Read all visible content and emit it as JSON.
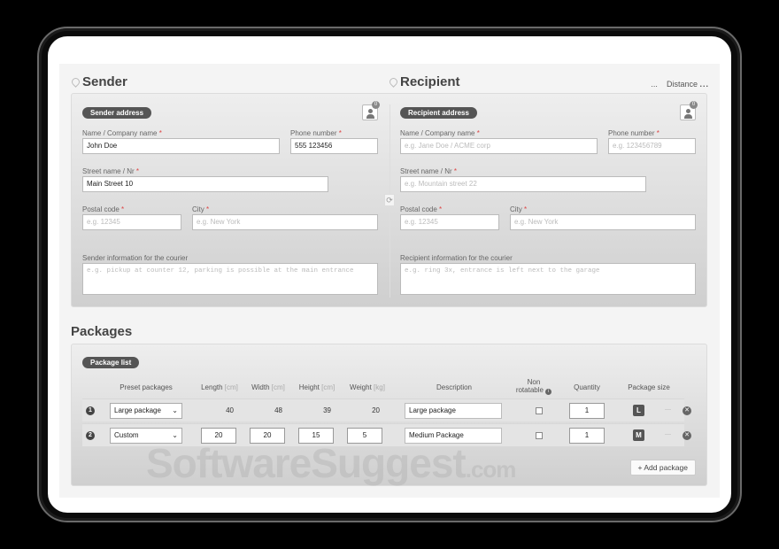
{
  "sender": {
    "title": "Sender",
    "pill": "Sender address",
    "badge": "0",
    "name_label": "Name / Company name",
    "name_value": "John Doe",
    "phone_label": "Phone number",
    "phone_value": "555 123456",
    "street_label": "Street name / Nr",
    "street_value": "Main Street 10",
    "postal_label": "Postal code",
    "postal_placeholder": "e.g. 12345",
    "city_label": "City",
    "city_placeholder": "e.g. New York",
    "info_label": "Sender information for the courier",
    "info_placeholder": "e.g. pickup at counter 12, parking is possible at the main entrance"
  },
  "recipient": {
    "title": "Recipient",
    "pill": "Recipient address",
    "badge": "0",
    "name_label": "Name / Company name",
    "name_placeholder": "e.g. Jane Doe / ACME corp",
    "phone_label": "Phone number",
    "phone_placeholder": "e.g. 123456789",
    "street_label": "Street name / Nr",
    "street_placeholder": "e.g. Mountain street 22",
    "postal_label": "Postal code",
    "postal_placeholder": "e.g. 12345",
    "city_label": "City",
    "city_placeholder": "e.g. New York",
    "info_label": "Recipient information for the courier",
    "info_placeholder": "e.g. ring 3x, entrance is left next to the garage"
  },
  "distance": {
    "prefix": "...",
    "label": "Distance",
    "value": "..."
  },
  "required_mark": "*",
  "packages": {
    "title": "Packages",
    "pill": "Package list",
    "headers": {
      "preset": "Preset packages",
      "length": "Length",
      "width": "Width",
      "height": "Height",
      "weight": "Weight",
      "unit_cm": "[cm]",
      "unit_kg": "[kg]",
      "description": "Description",
      "non_rotatable_1": "Non",
      "non_rotatable_2": "rotatable",
      "quantity": "Quantity",
      "package_size": "Package size"
    },
    "rows": [
      {
        "num": "1",
        "preset": "Large package",
        "length": "40",
        "width": "48",
        "height": "39",
        "weight": "20",
        "description": "Large package",
        "quantity": "1",
        "size": "L"
      },
      {
        "num": "2",
        "preset": "Custom",
        "length": "20",
        "width": "20",
        "height": "15",
        "weight": "5",
        "description": "Medium Package",
        "quantity": "1",
        "size": "M"
      }
    ],
    "add_button": "+ Add package"
  },
  "watermark": {
    "main": "SoftwareSuggest",
    "suffix": ".com"
  }
}
